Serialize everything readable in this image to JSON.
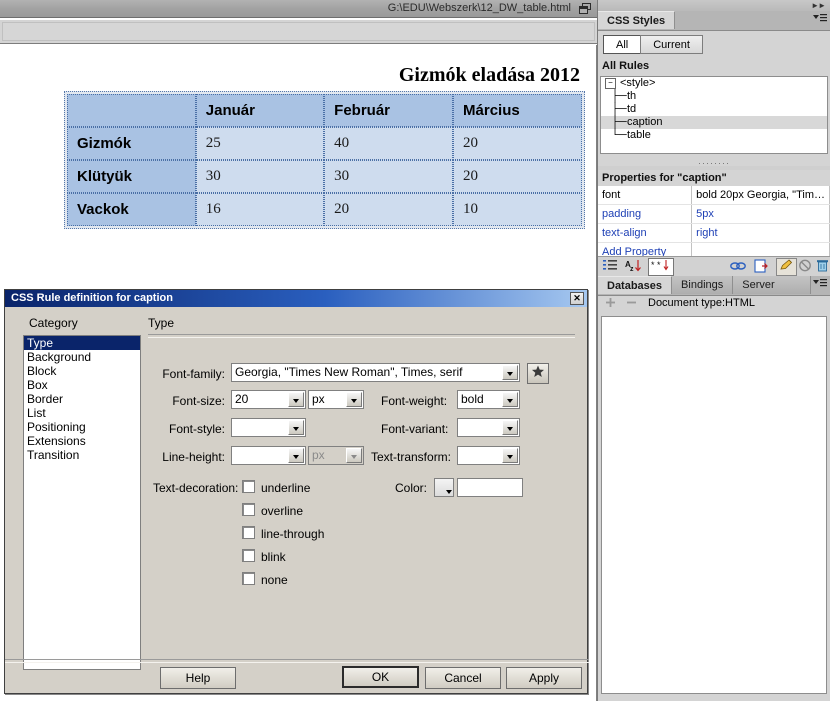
{
  "document_window": {
    "path": "G:\\EDU\\Webszerk\\12_DW_table.html",
    "restore_icon": "restore-window-icon"
  },
  "page": {
    "caption": "Gizmók eladása 2012",
    "table": {
      "corner_header": "",
      "column_headers": [
        "Január",
        "Február",
        "Március"
      ],
      "rows": [
        {
          "label": "Gizmók",
          "values": [
            "25",
            "40",
            "20"
          ]
        },
        {
          "label": "Klütyük",
          "values": [
            "30",
            "30",
            "20"
          ]
        },
        {
          "label": "Vackok",
          "values": [
            "16",
            "20",
            "10"
          ]
        }
      ]
    }
  },
  "css_styles_panel": {
    "tab_label": "CSS Styles",
    "menu_icon": "panel-menu-icon",
    "segments": [
      {
        "label": "All",
        "active": true
      },
      {
        "label": "Current",
        "active": false
      }
    ],
    "all_rules_label": "All Rules",
    "rules": [
      {
        "label": "<style>",
        "level": 0,
        "selected": false,
        "toggle": "minus-toggle-icon"
      },
      {
        "label": "th",
        "level": 1,
        "selected": false
      },
      {
        "label": "td",
        "level": 1,
        "selected": false
      },
      {
        "label": "caption",
        "level": 1,
        "selected": true
      },
      {
        "label": "table",
        "level": 1,
        "selected": false
      }
    ],
    "properties_label": "Properties for \"caption\"",
    "properties": [
      {
        "name": "font",
        "value": "bold 20px Georgia, \"Tim…",
        "name_style": "plain",
        "value_style": "plain"
      },
      {
        "name": "padding",
        "value": "5px",
        "name_style": "blue",
        "value_style": "blue"
      },
      {
        "name": "text-align",
        "value": "right",
        "name_style": "blue",
        "value_style": "blue"
      },
      {
        "name": "Add Property",
        "value": "",
        "name_style": "link",
        "value_style": "plain"
      }
    ],
    "toolbar_icons": [
      "category-view-icon",
      "alphabetical-view-icon",
      "set-properties-view-icon",
      "attach-style-sheet-icon",
      "new-css-rule-icon",
      "edit-rule-icon",
      "disable-css-property-icon",
      "delete-css-rule-icon"
    ]
  },
  "databases_panel": {
    "tabs": [
      {
        "label": "Databases",
        "active": true
      },
      {
        "label": "Bindings",
        "active": false
      },
      {
        "label": "Server Behaviors",
        "active": false
      }
    ],
    "menu_icon": "panel-menu-icon",
    "add_icon": "plus-icon",
    "remove_icon": "minus-icon",
    "status": "Document type:HTML"
  },
  "dialog": {
    "title": "CSS Rule definition for caption",
    "close_label": "✕",
    "close_icon": "close-icon",
    "category_label": "Category",
    "categories": [
      {
        "label": "Type",
        "selected": true
      },
      {
        "label": "Background",
        "selected": false
      },
      {
        "label": "Block",
        "selected": false
      },
      {
        "label": "Box",
        "selected": false
      },
      {
        "label": "Border",
        "selected": false
      },
      {
        "label": "List",
        "selected": false
      },
      {
        "label": "Positioning",
        "selected": false
      },
      {
        "label": "Extensions",
        "selected": false
      },
      {
        "label": "Transition",
        "selected": false
      }
    ],
    "section_title": "Type",
    "fields": {
      "font_family_label": "Font-family:",
      "font_family_value": "Georgia, \"Times New Roman\", Times, serif",
      "font_family_star_icon": "favorite-star-icon",
      "font_size_label": "Font-size:",
      "font_size_value": "20",
      "font_size_unit": "px",
      "font_weight_label": "Font-weight:",
      "font_weight_value": "bold",
      "font_style_label": "Font-style:",
      "font_style_value": "",
      "font_variant_label": "Font-variant:",
      "font_variant_value": "",
      "line_height_label": "Line-height:",
      "line_height_value": "",
      "line_height_unit": "px",
      "text_transform_label": "Text-transform:",
      "text_transform_value": "",
      "text_decoration_label": "Text-decoration:",
      "text_decoration_options": [
        {
          "label": "underline",
          "checked": false
        },
        {
          "label": "overline",
          "checked": false
        },
        {
          "label": "line-through",
          "checked": false
        },
        {
          "label": "blink",
          "checked": false
        },
        {
          "label": "none",
          "checked": false
        }
      ],
      "color_label": "Color:",
      "color_value": "",
      "color_swatch_icon": "color-picker-icon"
    },
    "buttons": {
      "help": "Help",
      "ok": "OK",
      "cancel": "Cancel",
      "apply": "Apply"
    }
  },
  "colors": {
    "table_header_bg": "#a9c2e3",
    "table_cell_bg": "#cedcee",
    "table_outer_bg": "#e2e8f0",
    "dialog_titlebar": "#0a246a",
    "selection": "#0a246a",
    "panel_bg": "#d4d4d4",
    "link_blue": "#1d3fb5"
  }
}
